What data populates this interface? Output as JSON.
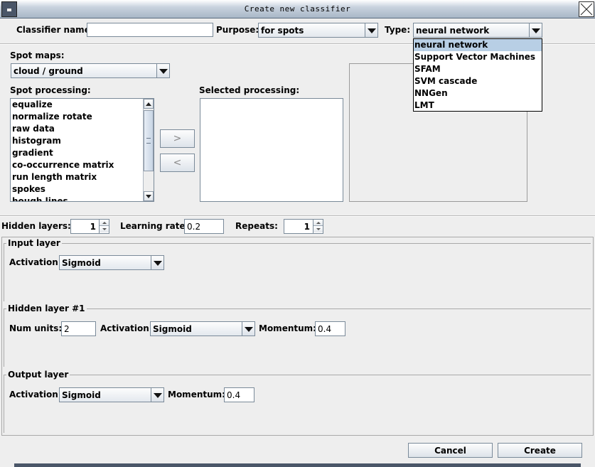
{
  "window": {
    "title": "Create new classifier"
  },
  "top": {
    "classifier_name_label": "Classifier name:",
    "classifier_name_value": "",
    "purpose_label": "Purpose:",
    "purpose_value": "for spots",
    "type_label": "Type:",
    "type_value": "neural network",
    "type_options": [
      "neural network",
      "Support Vector Machines",
      "SFAM",
      "SVM cascade",
      "NNGen",
      "LMT"
    ],
    "type_selected_index": 0
  },
  "spot_maps": {
    "label": "Spot maps:",
    "value": "cloud / ground"
  },
  "spot_processing": {
    "label": "Spot processing:",
    "items": [
      "equalize",
      "normalize rotate",
      "raw data",
      "histogram",
      "gradient",
      "co-occurrence matrix",
      "run length matrix",
      "spokes",
      "hough lines"
    ]
  },
  "transfer": {
    "add_label": ">",
    "remove_label": "<"
  },
  "selected_processing": {
    "label": "Selected processing:",
    "items": []
  },
  "params": {
    "hidden_layers_label": "Hidden layers:",
    "hidden_layers_value": "1",
    "learning_rate_label": "Learning rate:",
    "learning_rate_value": "0.2",
    "repeats_label": "Repeats:",
    "repeats_value": "1"
  },
  "input_layer": {
    "title": "Input layer",
    "activation_label": "Activation:",
    "activation_value": "Sigmoid"
  },
  "hidden_layer": {
    "title": "Hidden layer #1",
    "num_units_label": "Num units:",
    "num_units_value": "2",
    "activation_label": "Activation:",
    "activation_value": "Sigmoid",
    "momentum_label": "Momentum:",
    "momentum_value": "0.4"
  },
  "output_layer": {
    "title": "Output layer",
    "activation_label": "Activation:",
    "activation_value": "Sigmoid",
    "momentum_label": "Momentum:",
    "momentum_value": "0.4"
  },
  "footer": {
    "cancel_label": "Cancel",
    "create_label": "Create"
  },
  "colors": {
    "title_gradient_end": "#a9b7c7",
    "selection": "#b8cfe5",
    "background": "#eeeeee"
  }
}
